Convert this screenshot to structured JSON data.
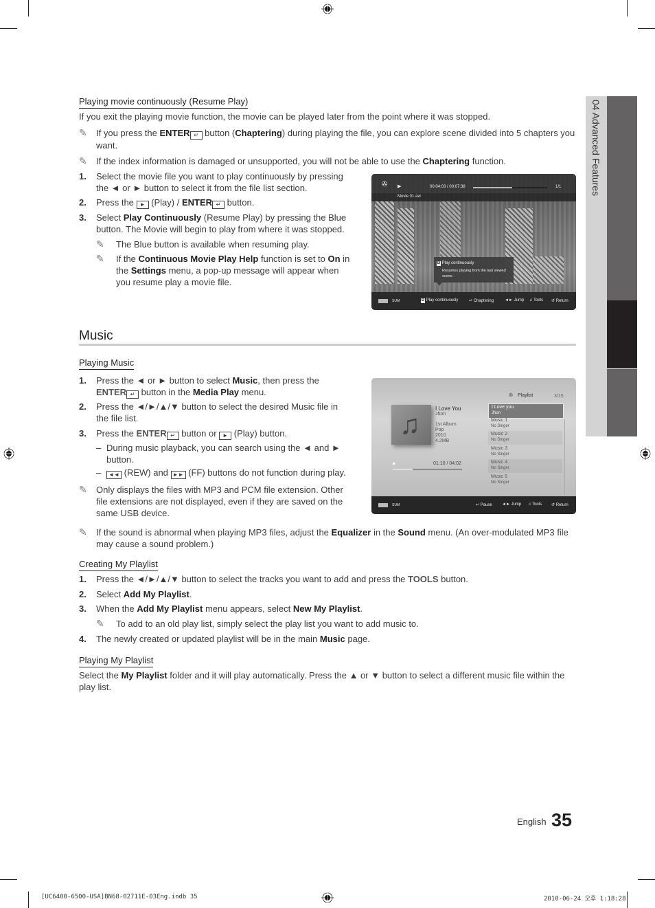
{
  "side_tab": {
    "label": "04  Advanced Features"
  },
  "resume": {
    "heading": "Playing movie continuously (Resume Play)",
    "intro": "If you exit the playing movie function, the movie can be played later from the point where it was stopped.",
    "note1": {
      "a": "If you press the ",
      "b": "ENTER",
      "c": " button (",
      "d": "Chaptering",
      "e": ") during playing the file, you can explore scene divided into 5 chapters you want."
    },
    "note2": {
      "a": "If the index information is damaged or unsupported, you will not be able to use the ",
      "b": "Chaptering",
      "c": " function."
    },
    "steps": [
      {
        "num": "1.",
        "text": "Select the movie file you want to play continuously by pressing the ◄ or ► button to select it from the file list section."
      },
      {
        "num": "2.",
        "a": "Press the ",
        "key": "►",
        "b": " (Play) / ",
        "c": "ENTER",
        "d": " button."
      },
      {
        "num": "3.",
        "a": "Select ",
        "b": "Play Continuously",
        "c": " (Resume Play) by pressing the Blue button. The Movie will begin to play from where it was stopped."
      }
    ],
    "subnote1": "The Blue button is available when resuming play.",
    "subnote2": {
      "a": "If the ",
      "b": "Continuous Movie Play Help",
      "c": " function is set to ",
      "d": "On",
      "e": " in the ",
      "f": "Settings",
      "g": " menu, a pop-up message will appear when you resume play a movie file."
    }
  },
  "movie_screen": {
    "time": "00:04:03 / 00:07:38",
    "progress": 0.53,
    "count": "1/1",
    "filename": "Movie 01.avi",
    "popup_key": "D",
    "popup_title": "Play continuously",
    "popup_desc": "Resumes playing from the last viewed scene.",
    "device": "SUM",
    "controls": [
      {
        "key": "D",
        "label": "Play continuously"
      },
      {
        "icon": "enter",
        "label": "Chaptering"
      },
      {
        "icon": "◄►",
        "label": "Jump"
      },
      {
        "icon": "tools",
        "label": "Tools"
      },
      {
        "icon": "↺",
        "label": "Return"
      }
    ]
  },
  "music": {
    "title": "Music",
    "playing_heading": "Playing Music",
    "steps": [
      {
        "num": "1.",
        "a": "Press the ◄ or ► button to select ",
        "b": "Music",
        "c": ", then press the ",
        "d": "ENTER",
        "e": " button in the ",
        "f": "Media Play",
        "g": " menu."
      },
      {
        "num": "2.",
        "text": "Press the ◄/►/▲/▼ button to select the desired Music file in the file list."
      },
      {
        "num": "3.",
        "a": "Press the ",
        "b": "ENTER",
        "c": " button or ",
        "key": "►",
        "d": " (Play) button."
      }
    ],
    "dash1": "During music playback, you can search using the ◄ and ► button.",
    "dash2": {
      "key1": "◄◄",
      "a": " (REW) and ",
      "key2": "►►",
      "b": " (FF) buttons do not function during play."
    },
    "note_ext": "Only displays the files with MP3 and PCM file extension. Other file extensions are not displayed, even if they are saved on the same USB device.",
    "note_sound": {
      "a": "If the sound is abnormal when playing MP3 files, adjust the ",
      "b": "Equalizer",
      "c": " in the ",
      "d": "Sound",
      "e": " menu. (An over-modulated MP3 file may cause a sound problem.)"
    }
  },
  "music_screen": {
    "playlist_label": "Playlist",
    "count": "3/15",
    "track_title": "I Love You",
    "artist": "Jhon",
    "album": "1st Album",
    "genre": "Pop",
    "year": "2010",
    "size": "4.2MB",
    "time": "01:10 / 04:02",
    "progress": 0.29,
    "playlist": [
      {
        "title": "I Love you",
        "singer": "Jhon",
        "selected": true
      },
      {
        "title": "Music 1",
        "singer": "No Singer"
      },
      {
        "title": "Music 2",
        "singer": "No Singer"
      },
      {
        "title": "Music 3",
        "singer": "No Singer"
      },
      {
        "title": "Music 4",
        "singer": "No Singer"
      },
      {
        "title": "Music 5",
        "singer": "No Singer"
      }
    ],
    "device": "SUM",
    "controls": [
      {
        "icon": "enter",
        "label": "Pause"
      },
      {
        "icon": "◄►",
        "label": "Jump"
      },
      {
        "icon": "tools",
        "label": "Tools"
      },
      {
        "icon": "↺",
        "label": "Return"
      }
    ]
  },
  "creating": {
    "heading": "Creating My Playlist",
    "steps": [
      {
        "num": "1.",
        "a": "Press the ◄/►/▲/▼ button to select the tracks you want to add and press the ",
        "b": "TOOLS",
        "c": " button."
      },
      {
        "num": "2.",
        "a": "Select ",
        "b": "Add My Playlist",
        "c": "."
      },
      {
        "num": "3.",
        "a": "When the ",
        "b": "Add My Playlist",
        "c": " menu appears, select ",
        "d": "New My Playlist",
        "e": "."
      },
      {
        "num": "4.",
        "a": "The newly created or updated playlist will be in the main ",
        "b": "Music",
        "c": " page."
      }
    ],
    "subnote": "To add to an old play list, simply select the play list you want to add music to."
  },
  "playing_playlist": {
    "heading": "Playing My Playlist",
    "a": "Select the ",
    "b": "My Playlist",
    "c": " folder and it will play automatically. Press the ▲ or ▼ button to select a different music file within the play list."
  },
  "page": {
    "language": "English",
    "number": "35"
  },
  "print_footer": {
    "file": "[UC6400-6500-USA]BN68-02711E-03Eng.indb   35",
    "timestamp": "2010-06-24   오후 1:18:28"
  },
  "icons": {
    "note": "✎",
    "enter": "↵"
  }
}
